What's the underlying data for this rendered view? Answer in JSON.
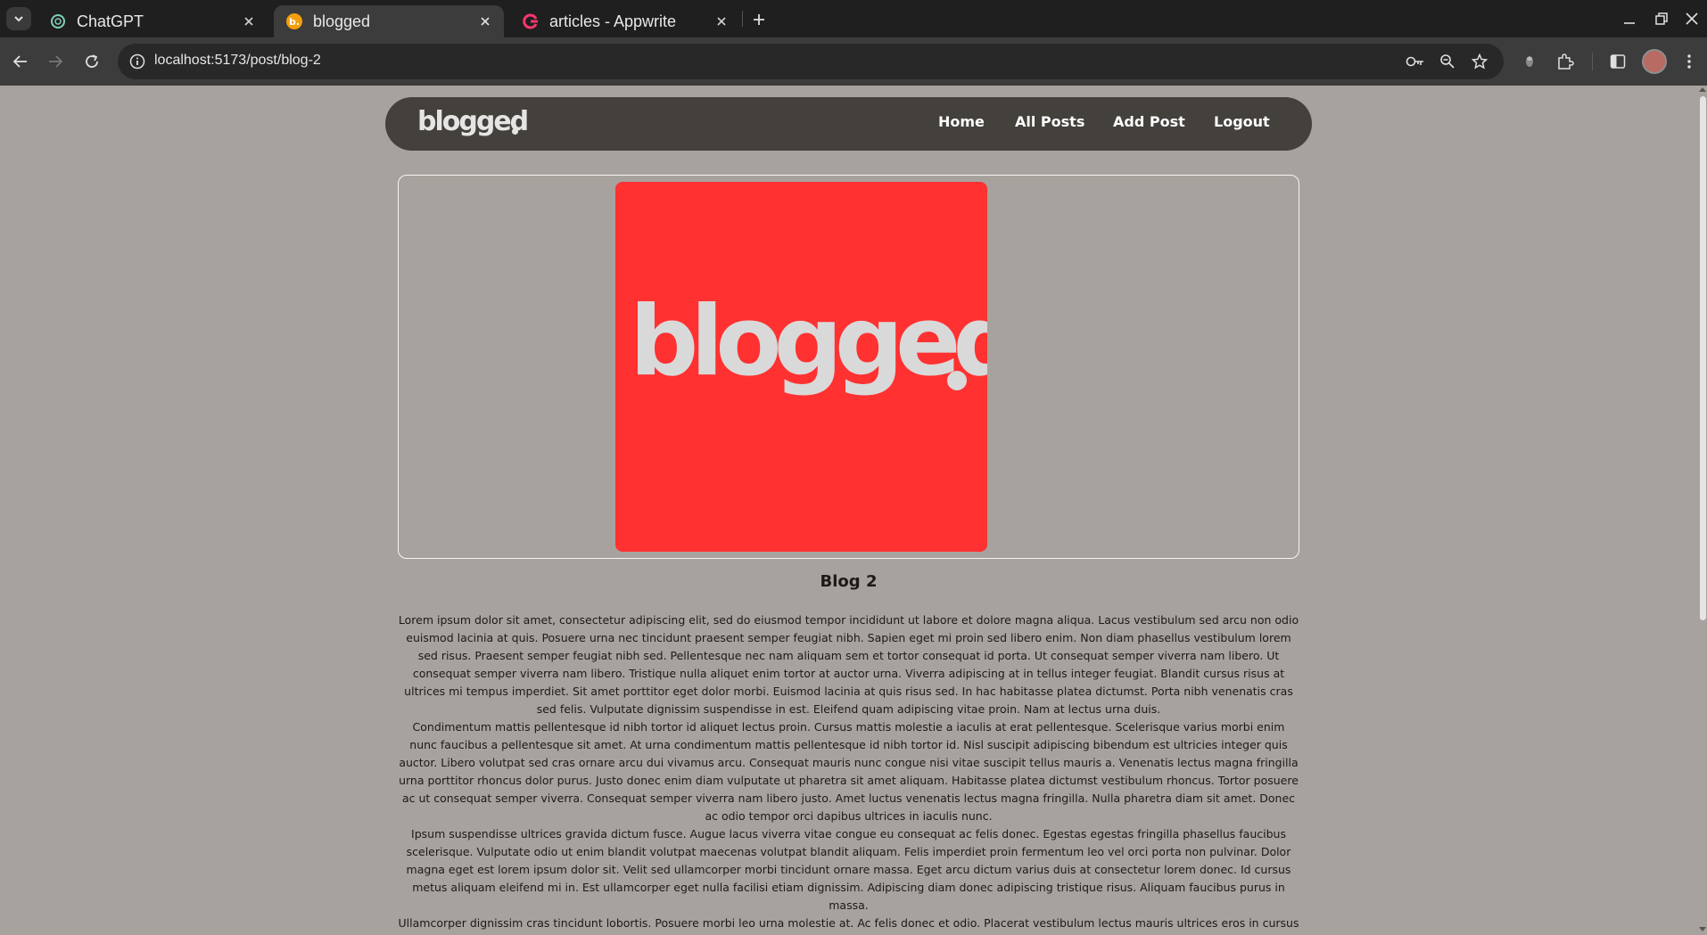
{
  "browser": {
    "tabs": [
      {
        "title": "ChatGPT",
        "icon": "chatgpt-favicon",
        "active": false
      },
      {
        "title": "blogged",
        "icon": "blogged-favicon",
        "active": true
      },
      {
        "title": "articles - Appwrite",
        "icon": "appwrite-favicon",
        "active": false
      }
    ],
    "favicon_letters": {
      "blogged": "b."
    },
    "url": "localhost:5173/post/blog-2"
  },
  "site": {
    "logo": "blogged",
    "nav": [
      {
        "label": "Home"
      },
      {
        "label": "All Posts"
      },
      {
        "label": "Add Post"
      },
      {
        "label": "Logout"
      }
    ]
  },
  "post": {
    "featured_image_text": "blogged",
    "title": "Blog 2",
    "paragraphs": [
      "Lorem ipsum dolor sit amet, consectetur adipiscing elit, sed do eiusmod tempor incididunt ut labore et dolore magna aliqua. Lacus vestibulum sed arcu non odio euismod lacinia at quis. Posuere urna nec tincidunt praesent semper feugiat nibh. Sapien eget mi proin sed libero enim. Non diam phasellus vestibulum lorem sed risus. Praesent semper feugiat nibh sed. Pellentesque nec nam aliquam sem et tortor consequat id porta. Ut consequat semper viverra nam libero. Ut consequat semper viverra nam libero. Tristique nulla aliquet enim tortor at auctor urna. Viverra adipiscing at in tellus integer feugiat. Blandit cursus risus at ultrices mi tempus imperdiet. Sit amet porttitor eget dolor morbi. Euismod lacinia at quis risus sed. In hac habitasse platea dictumst. Porta nibh venenatis cras sed felis. Vulputate dignissim suspendisse in est. Eleifend quam adipiscing vitae proin. Nam at lectus urna duis.",
      "Condimentum mattis pellentesque id nibh tortor id aliquet lectus proin. Cursus mattis molestie a iaculis at erat pellentesque. Scelerisque varius morbi enim nunc faucibus a pellentesque sit amet. At urna condimentum mattis pellentesque id nibh tortor id. Nisl suscipit adipiscing bibendum est ultricies integer quis auctor. Libero volutpat sed cras ornare arcu dui vivamus arcu. Consequat mauris nunc congue nisi vitae suscipit tellus mauris a. Venenatis lectus magna fringilla urna porttitor rhoncus dolor purus. Justo donec enim diam vulputate ut pharetra sit amet aliquam. Habitasse platea dictumst vestibulum rhoncus. Tortor posuere ac ut consequat semper viverra. Consequat semper viverra nam libero justo. Amet luctus venenatis lectus magna fringilla. Nulla pharetra diam sit amet. Donec ac odio tempor orci dapibus ultrices in iaculis nunc.",
      "Ipsum suspendisse ultrices gravida dictum fusce. Augue lacus viverra vitae congue eu consequat ac felis donec. Egestas egestas fringilla phasellus faucibus scelerisque. Vulputate odio ut enim blandit volutpat maecenas volutpat blandit aliquam. Felis imperdiet proin fermentum leo vel orci porta non pulvinar. Dolor magna eget est lorem ipsum dolor sit. Velit sed ullamcorper morbi tincidunt ornare massa. Eget arcu dictum varius duis at consectetur lorem donec. Id cursus metus aliquam eleifend mi in. Est ullamcorper eget nulla facilisi etiam dignissim. Adipiscing diam donec adipiscing tristique risus. Aliquam faucibus purus in massa.",
      "Ullamcorper dignissim cras tincidunt lobortis. Posuere morbi leo urna molestie at. Ac felis donec et odio. Placerat vestibulum lectus mauris ultrices eros in cursus turpis massa. Tincidunt praesent semper feugiat nibh sed pulvinar. Rutrum quisque non tellus orci ac auctor augue mauris. Turpis in eu mi bibendum neque egestas congue"
    ]
  },
  "colors": {
    "page_bg": "#a8a29e",
    "nav_bg": "#44403c",
    "featured_bg": "#ff3131",
    "logo_text": "#d9d9d9",
    "chrome_dark": "#1f1f1f",
    "chrome_toolbar": "#3c3c3c"
  }
}
